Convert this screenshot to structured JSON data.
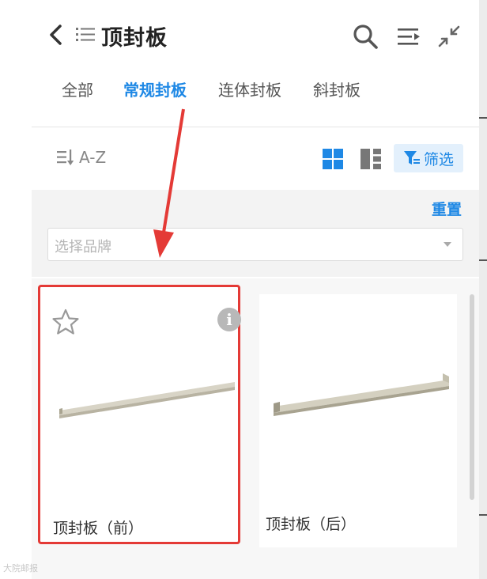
{
  "header": {
    "title": "顶封板",
    "icons": [
      "back-icon",
      "list-icon",
      "search-icon",
      "sort-lines-icon",
      "shrink-icon"
    ]
  },
  "tabs": [
    {
      "label": "全部",
      "active": false
    },
    {
      "label": "常规封板",
      "active": true
    },
    {
      "label": "连体封板",
      "active": false
    },
    {
      "label": "斜封板",
      "active": false
    }
  ],
  "toolbar": {
    "sort_label": "A-Z",
    "filter_label": "筛选"
  },
  "filter": {
    "reset_label": "重置",
    "brand_placeholder": "选择品牌"
  },
  "products": [
    {
      "name": "顶封板（前）",
      "highlighted": true
    },
    {
      "name": "顶封板（后）",
      "highlighted": false
    }
  ],
  "colors": {
    "accent": "#1e88e5",
    "highlight": "#e43a36"
  },
  "watermark": "大院邮报"
}
